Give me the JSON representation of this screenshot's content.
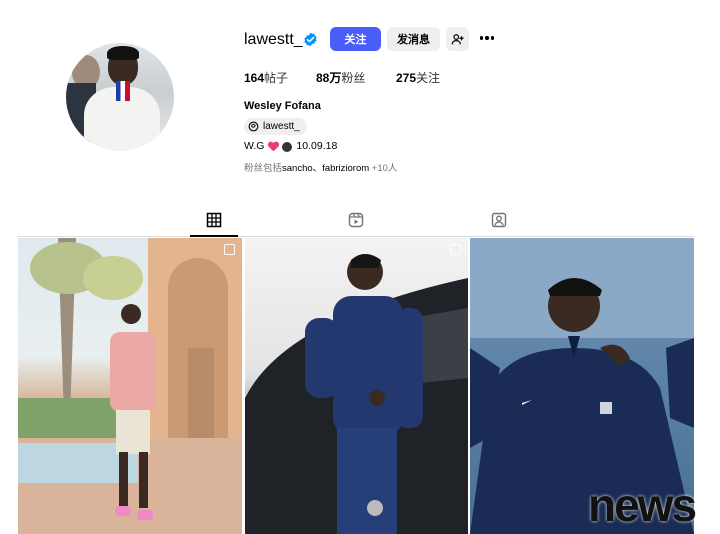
{
  "profile": {
    "username": "lawestt_",
    "verified": true,
    "full_name": "Wesley Fofana",
    "threads_handle": "lawestt_",
    "bio_prefix": "W.G",
    "bio_date": "10.09.18",
    "followed_by_prefix": "粉丝包括",
    "followed_by_names": "sancho、fabriziorom",
    "followed_by_more": "+10人"
  },
  "actions": {
    "follow_label": "关注",
    "message_label": "发消息"
  },
  "stats": {
    "posts_count": "164",
    "posts_label": "帖子",
    "followers_count": "88万",
    "followers_label": "粉丝",
    "following_count": "275",
    "following_label": "关注"
  },
  "tabs": [
    {
      "name": "posts",
      "icon": "grid-icon",
      "active": true
    },
    {
      "name": "reels",
      "icon": "reels-icon",
      "active": false
    },
    {
      "name": "tagged",
      "icon": "tagged-icon",
      "active": false
    }
  ],
  "posts": [
    {
      "icon": "carousel-icon"
    },
    {
      "icon": "carousel-icon"
    },
    {
      "icon": ""
    }
  ],
  "watermark": "news",
  "colors": {
    "accent": "#4a5df9",
    "verified": "#0095f6"
  }
}
